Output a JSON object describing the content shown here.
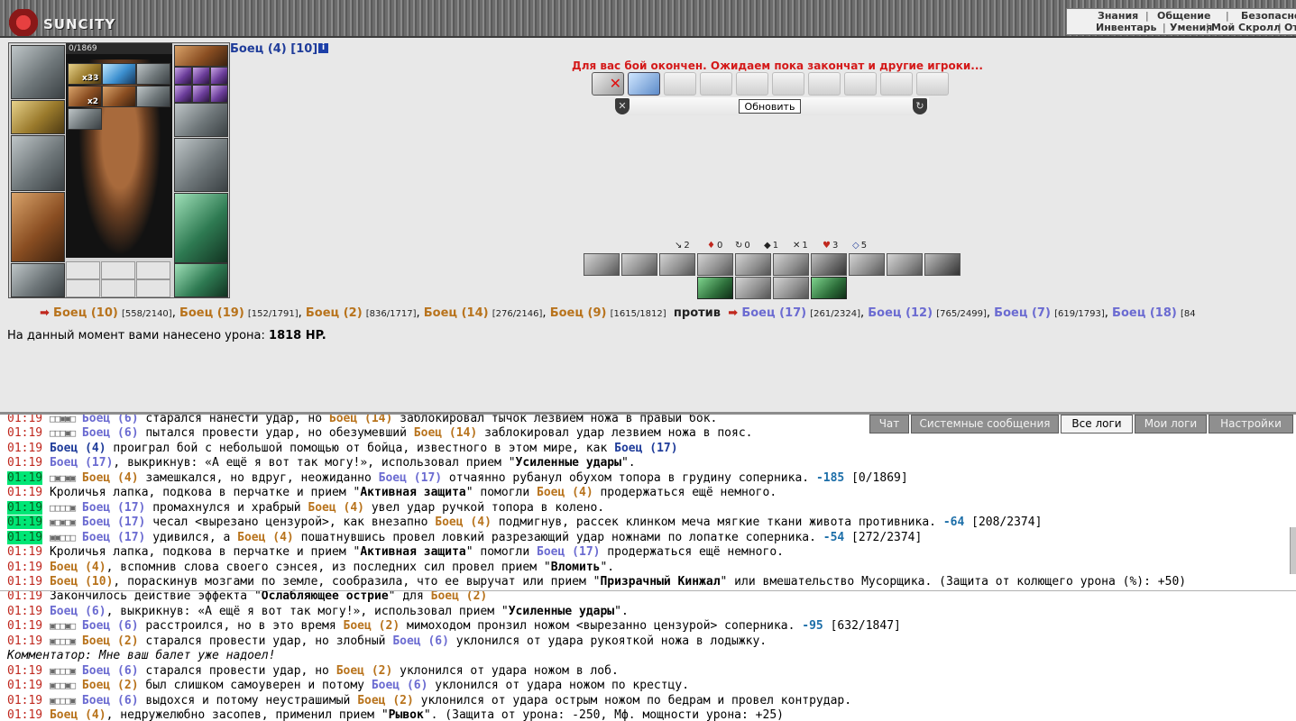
{
  "brand": {
    "logo_text": "SUNCITY"
  },
  "topnav": {
    "row1": [
      "Знания",
      "Общение",
      "Безопасно"
    ],
    "row2": [
      "Инвентарь",
      "Умения",
      "Мой Скролл",
      "От"
    ]
  },
  "character": {
    "hp": "0/1869",
    "counter1": "x33",
    "counter2": "x2"
  },
  "header": {
    "fighter": "Боец (4) [10]",
    "info_icon": "i",
    "battle_message": "Для вас бой окончен. Ожидаем пока закончат и другие игроки...",
    "refresh_button": "Обновить"
  },
  "stats": [
    {
      "icon": "↘",
      "value": "2"
    },
    {
      "icon": "♦",
      "value": "0"
    },
    {
      "icon": "↻",
      "value": "0"
    },
    {
      "icon": "◆",
      "value": "1"
    },
    {
      "icon": "✕",
      "value": "1"
    },
    {
      "icon": "♥",
      "value": "3"
    },
    {
      "icon": "◇",
      "value": "5"
    }
  ],
  "teams": {
    "team1": [
      {
        "name": "Боец (10)",
        "hp": "[558/2140]"
      },
      {
        "name": "Боец (19)",
        "hp": "[152/1791]"
      },
      {
        "name": "Боец (2)",
        "hp": "[836/1717]"
      },
      {
        "name": "Боец (14)",
        "hp": "[276/2146]"
      },
      {
        "name": "Боец (9)",
        "hp": "[1615/1812]"
      }
    ],
    "versus": "против",
    "team2": [
      {
        "name": "Боец (17)",
        "hp": "[261/2324]"
      },
      {
        "name": "Боец (12)",
        "hp": "[765/2499]"
      },
      {
        "name": "Боец (7)",
        "hp": "[619/1793]"
      },
      {
        "name": "Боец (18)",
        "hp": "[84"
      }
    ]
  },
  "damage": {
    "text": "На данный момент вами нанесено урона:",
    "value": "1818 HP."
  },
  "tabs": [
    "Чат",
    "Системные сообщения",
    "Все логи",
    "Мои логи",
    "Настройки"
  ],
  "log": [
    {
      "time": "01:19",
      "boxes": "□□▣▣□",
      "segs": [
        [
          "n2",
          "Боец (6)"
        ],
        [
          "t",
          " старался нанести удар, но "
        ],
        [
          "n1",
          "Боец (14)"
        ],
        [
          "t",
          " заблокировал тычок лезвием ножа в правый бок."
        ]
      ]
    },
    {
      "time": "01:19",
      "boxes": "□□□▣□",
      "segs": [
        [
          "n2",
          "Боец (6)"
        ],
        [
          "t",
          " пытался провести удар, но обезумевший "
        ],
        [
          "n1",
          "Боец (14)"
        ],
        [
          "t",
          " заблокировал удар лезвием ножа в пояс."
        ]
      ]
    },
    {
      "time": "01:19",
      "segs": [
        [
          "nb",
          "Боец (4)"
        ],
        [
          "t",
          " проиграл бой с небольшой помощью от бойца, известного в этом мире, как "
        ],
        [
          "nb",
          "Боец (17)"
        ]
      ]
    },
    {
      "time": "01:19",
      "segs": [
        [
          "n2",
          "Боец (17)"
        ],
        [
          "t",
          ", выкрикнув: «А ещё я вот так могу!», использовал прием \""
        ],
        [
          "b",
          "Усиленные удары"
        ],
        [
          "t",
          "\"."
        ]
      ]
    },
    {
      "time": "01:19",
      "hl": true,
      "boxes": "□▣□▣▣",
      "segs": [
        [
          "n1",
          "Боец (4)"
        ],
        [
          "t",
          " замешкался, но вдруг, неожиданно "
        ],
        [
          "n2",
          "Боец (17)"
        ],
        [
          "t",
          " отчаянно рубанул обухом топора в грудину соперника. "
        ],
        [
          "d",
          "-185"
        ],
        [
          "t",
          " [0/1869]"
        ]
      ]
    },
    {
      "time": "01:19",
      "segs": [
        [
          "t",
          "Кроличья лапка, подкова в перчатке и прием \""
        ],
        [
          "b",
          "Активная защита"
        ],
        [
          "t",
          "\" помогли "
        ],
        [
          "n1",
          "Боец (4)"
        ],
        [
          "t",
          " продержаться ещё немного."
        ]
      ]
    },
    {
      "time": "01:19",
      "hl": true,
      "boxes": "□□□□▣",
      "segs": [
        [
          "n2",
          "Боец (17)"
        ],
        [
          "t",
          " промахнулся и храбрый "
        ],
        [
          "n1",
          "Боец (4)"
        ],
        [
          "t",
          " увел удар ручкой топора в колено."
        ]
      ]
    },
    {
      "time": "01:19",
      "hl": true,
      "boxes": "▣□▣□▣",
      "segs": [
        [
          "n2",
          "Боец (17)"
        ],
        [
          "t",
          " чесал <вырезано цензурой>, как внезапно "
        ],
        [
          "n1",
          "Боец (4)"
        ],
        [
          "t",
          " подмигнув, рассек клинком меча мягкие ткани живота противника. "
        ],
        [
          "d",
          "-64"
        ],
        [
          "t",
          " [208/2374]"
        ]
      ]
    },
    {
      "time": "01:19",
      "hl": true,
      "boxes": "▣▣□□□",
      "segs": [
        [
          "n2",
          "Боец (17)"
        ],
        [
          "t",
          " удивился, а "
        ],
        [
          "n1",
          "Боец (4)"
        ],
        [
          "t",
          " пошатнувшись провел ловкий разрезающий удар ножнами по лопатке соперника. "
        ],
        [
          "d",
          "-54"
        ],
        [
          "t",
          " [272/2374]"
        ]
      ]
    },
    {
      "time": "01:19",
      "segs": [
        [
          "t",
          "Кроличья лапка, подкова в перчатке и прием \""
        ],
        [
          "b",
          "Активная защита"
        ],
        [
          "t",
          "\" помогли "
        ],
        [
          "n2",
          "Боец (17)"
        ],
        [
          "t",
          " продержаться ещё немного."
        ]
      ]
    },
    {
      "time": "01:19",
      "segs": [
        [
          "n1",
          "Боец (4)"
        ],
        [
          "t",
          ", вспомнив слова своего сэнсея, из последних сил провел прием \""
        ],
        [
          "b",
          "Вломить"
        ],
        [
          "t",
          "\"."
        ]
      ]
    },
    {
      "time": "01:19",
      "segs": [
        [
          "n1",
          "Боец (10)"
        ],
        [
          "t",
          ", пораскинув мозгами по земле, сообразила, что ее выручат или прием \""
        ],
        [
          "b",
          "Призрачный Кинжал"
        ],
        [
          "t",
          "\" или вмешательство Мусорщика. (Защита от колющего урона (%): +50)"
        ]
      ]
    },
    {
      "time": "01:19",
      "segs": [
        [
          "t",
          "Закончилось действие эффекта \""
        ],
        [
          "b",
          "Ослабляющее острие"
        ],
        [
          "t",
          "\" для "
        ],
        [
          "n1",
          "Боец (2)"
        ]
      ]
    },
    {
      "time": "01:19",
      "segs": [
        [
          "n2",
          "Боец (6)"
        ],
        [
          "t",
          ", выкрикнув: «А ещё я вот так могу!», использовал прием \""
        ],
        [
          "b",
          "Усиленные удары"
        ],
        [
          "t",
          "\"."
        ]
      ]
    },
    {
      "time": "01:19",
      "boxes": "▣□□▣□",
      "segs": [
        [
          "n2",
          "Боец (6)"
        ],
        [
          "t",
          " расстроился, но в это время "
        ],
        [
          "n1",
          "Боец (2)"
        ],
        [
          "t",
          " мимоходом пронзил ножом <вырезанно цензурой> соперника. "
        ],
        [
          "d",
          "-95"
        ],
        [
          "t",
          " [632/1847]"
        ]
      ]
    },
    {
      "time": "01:19",
      "boxes": "▣□□□▣",
      "segs": [
        [
          "n1",
          "Боец (2)"
        ],
        [
          "t",
          " старался провести удар, но злобный "
        ],
        [
          "n2",
          "Боец (6)"
        ],
        [
          "t",
          " уклонился от удара рукояткой ножа в лодыжку."
        ]
      ]
    },
    {
      "comment": "Комментатор: Мне ваш балет уже надоел!"
    },
    {
      "time": "01:19",
      "boxes": "▣□□□▣",
      "segs": [
        [
          "n2",
          "Боец (6)"
        ],
        [
          "t",
          " старался провести удар, но "
        ],
        [
          "n1",
          "Боец (2)"
        ],
        [
          "t",
          " уклонился от удара ножом в лоб."
        ]
      ]
    },
    {
      "time": "01:19",
      "boxes": "▣□□▣□",
      "segs": [
        [
          "n1",
          "Боец (2)"
        ],
        [
          "t",
          " был слишком самоуверен и потому "
        ],
        [
          "n2",
          "Боец (6)"
        ],
        [
          "t",
          " уклонился от удара ножом по крестцу."
        ]
      ]
    },
    {
      "time": "01:19",
      "boxes": "▣□□□▣",
      "segs": [
        [
          "n2",
          "Боец (6)"
        ],
        [
          "t",
          " выдохся и потому неустрашимый "
        ],
        [
          "n1",
          "Боец (2)"
        ],
        [
          "t",
          " уклонился от удара острым ножом по бедрам и провел контрудар."
        ]
      ]
    },
    {
      "time": "01:19",
      "segs": [
        [
          "n1",
          "Боец (4)"
        ],
        [
          "t",
          ", недружелюбно засопев, применил прием \""
        ],
        [
          "b",
          "Рывок"
        ],
        [
          "t",
          "\". (Защита от урона: -250, Мф. мощности урона: +25)"
        ]
      ]
    }
  ]
}
